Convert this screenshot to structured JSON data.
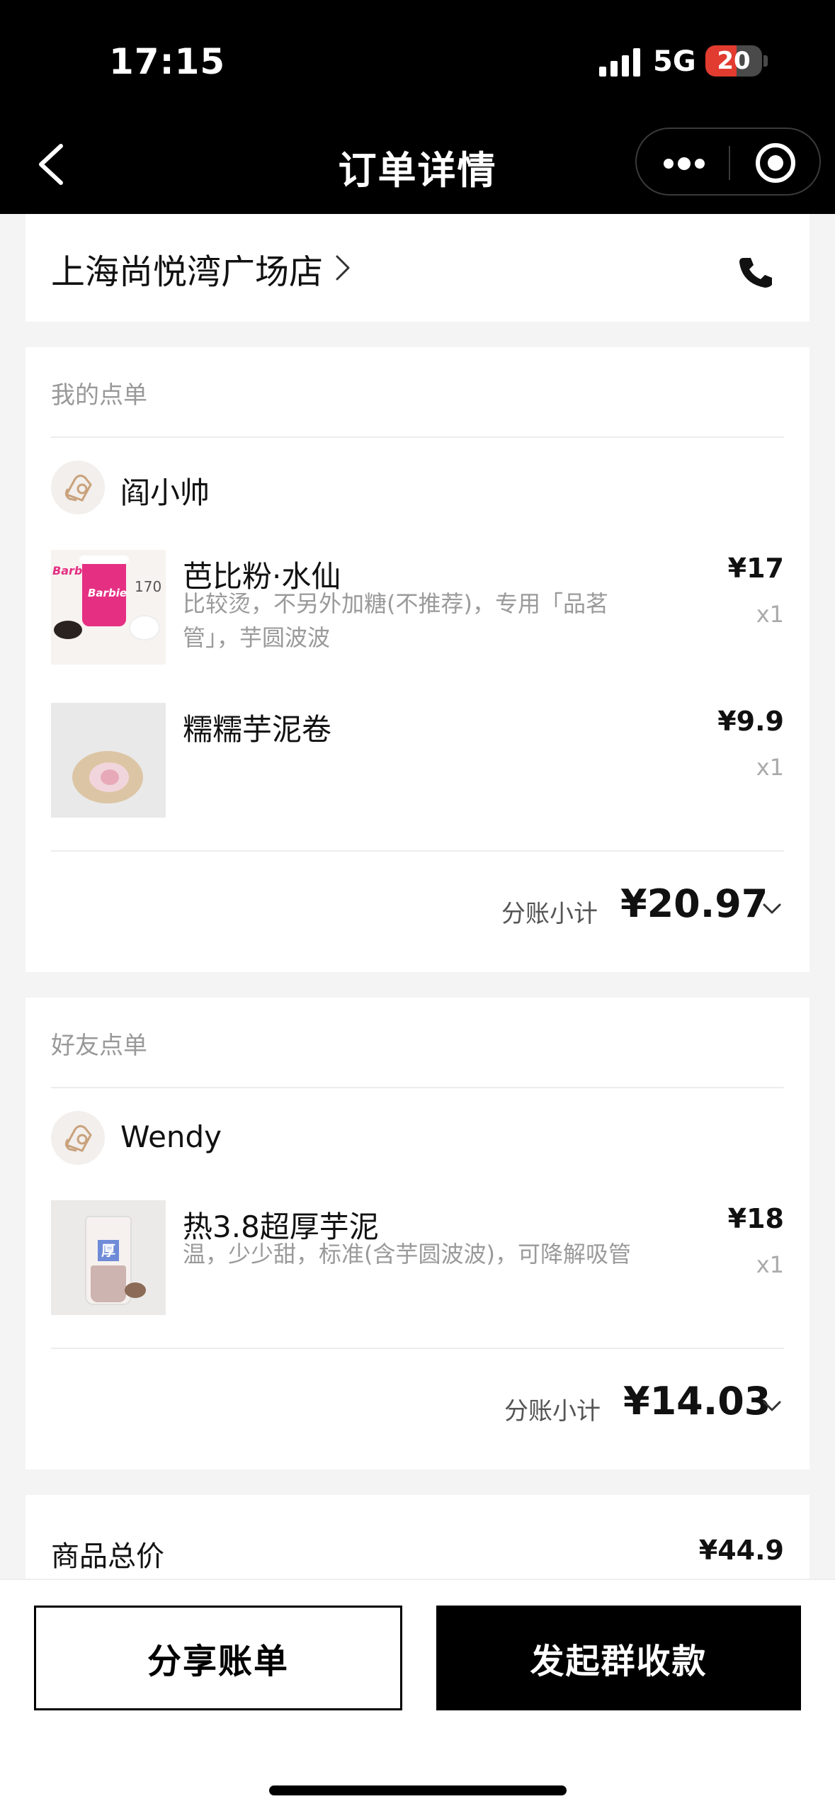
{
  "status_bar": {
    "time": "17:15",
    "network": "5G",
    "battery_level": "20",
    "battery_fraction": 0.2,
    "battery_color": "#e23b30"
  },
  "nav": {
    "title": "订单详情",
    "back_icon": "chevron-left-icon",
    "more_icon": "more-dots-icon",
    "close_icon": "target-icon"
  },
  "store": {
    "name": "上海尚悦湾广场店",
    "phone_icon": "phone-icon"
  },
  "my_order": {
    "section_title": "我的点单",
    "user_name": "阎小帅",
    "items": [
      {
        "name": "芭比粉·水仙",
        "desc": "比较烫，不另外加糖(不推荐)，专用「品茗管」，芋圆波波",
        "price": "¥17",
        "qty": "x1",
        "thumb_text": [
          "Barbie",
          "170"
        ]
      },
      {
        "name": "糯糯芋泥卷",
        "desc": "",
        "price": "¥9.9",
        "qty": "x1"
      }
    ],
    "subtotal_label": "分账小计",
    "subtotal_value": "¥20.97"
  },
  "friend_order": {
    "section_title": "好友点单",
    "user_name": "Wendy",
    "items": [
      {
        "name": "热3.8超厚芋泥",
        "desc": "温，少少甜，标准(含芋圆波波)，可降解吸管",
        "price": "¥18",
        "qty": "x1",
        "thumb_text": [
          "厚"
        ]
      }
    ],
    "subtotal_label": "分账小计",
    "subtotal_value": "¥14.03"
  },
  "summary": {
    "total_label": "商品总价",
    "total_value": "¥44.9"
  },
  "actions": {
    "share_label": "分享账单",
    "collect_label": "发起群收款"
  }
}
